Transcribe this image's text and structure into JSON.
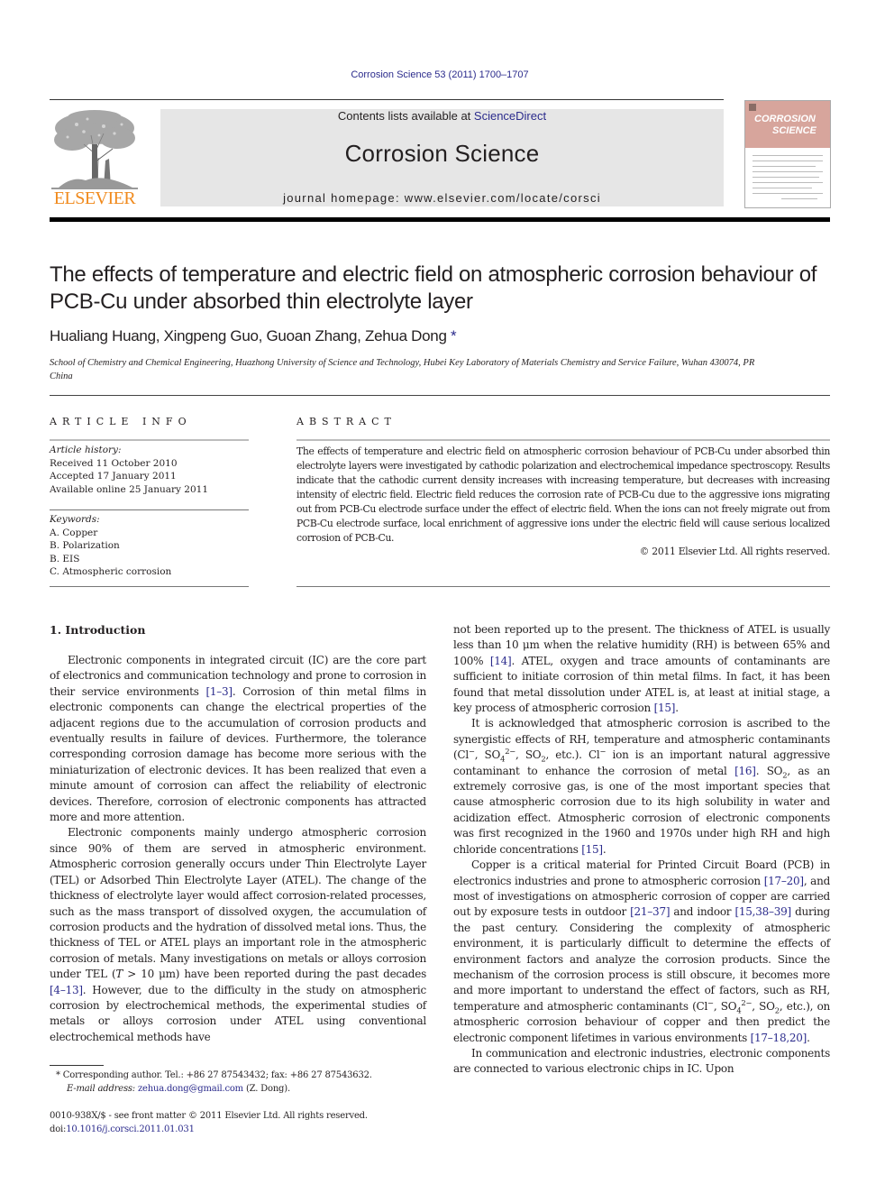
{
  "header": {
    "journal_ref": "Corrosion Science 53 (2011) 1700–1707",
    "contents_prefix": "Contents lists available at ",
    "contents_link": "ScienceDirect",
    "journal_title": "Corrosion Science",
    "homepage": "journal homepage: www.elsevier.com/locate/corsci",
    "publisher": "ELSEVIER",
    "cover_title_1": "CORROSION",
    "cover_title_2": "SCIENCE"
  },
  "article": {
    "title": "The effects of temperature and electric field on atmospheric corrosion behaviour of PCB-Cu under absorbed thin electrolyte layer",
    "authors": "Hualiang Huang, Xingpeng Guo, Guoan Zhang, Zehua Dong",
    "author_mark": "*",
    "affiliation": "School of Chemistry and Chemical Engineering, Huazhong University of Science and Technology, Hubei Key Laboratory of Materials Chemistry and Service Failure, Wuhan 430074, PR China"
  },
  "article_info": {
    "heading": "ARTICLE INFO",
    "history_label": "Article history:",
    "history": [
      "Received 11 October 2010",
      "Accepted 17 January 2011",
      "Available online 25 January 2011"
    ],
    "keywords_label": "Keywords:",
    "keywords": [
      "A. Copper",
      "B. Polarization",
      "B. EIS",
      "C. Atmospheric corrosion"
    ]
  },
  "abstract": {
    "heading": "ABSTRACT",
    "text": "The effects of temperature and electric field on atmospheric corrosion behaviour of PCB-Cu under absorbed thin electrolyte layers were investigated by cathodic polarization and electrochemical impedance spectroscopy. Results indicate that the cathodic current density increases with increasing temperature, but decreases with increasing intensity of electric field. Electric field reduces the corrosion rate of PCB-Cu due to the aggressive ions migrating out from PCB-Cu electrode surface under the effect of electric field. When the ions can not freely migrate out from PCB-Cu electrode surface, local enrichment of aggressive ions under the electric field will cause serious localized corrosion of PCB-Cu.",
    "copyright": "© 2011 Elsevier Ltd. All rights reserved."
  },
  "body": {
    "section_heading": "1. Introduction",
    "left": {
      "p1_a": "Electronic components in integrated circuit (IC) are the core part of electronics and communication technology and prone to corrosion in their service environments ",
      "p1_ref1": "[1–3]",
      "p1_b": ". Corrosion of thin metal films in electronic components can change the electrical properties of the adjacent regions due to the accumulation of corrosion products and eventually results in failure of devices. Furthermore, the tolerance corresponding corrosion damage has become more serious with the miniaturization of electronic devices. It has been realized that even a minute amount of corrosion can affect the reliability of electronic devices. Therefore, corrosion of electronic components has attracted more and more attention.",
      "p2_a": "Electronic components mainly undergo atmospheric corrosion since 90% of them are served in atmospheric environment. Atmospheric corrosion generally occurs under Thin Electrolyte Layer (TEL) or Adsorbed Thin Electrolyte Layer (ATEL). The change of the thickness of electrolyte layer would affect corrosion-related processes, such as the mass transport of dissolved oxygen, the accumulation of corrosion products and the hydration of dissolved metal ions. Thus, the thickness of TEL or ATEL plays an important role in the atmospheric corrosion of metals. Many investigations on metals or alloys corrosion under TEL (",
      "p2_T": "T",
      "p2_b": " > 10 μm) have been reported during the past decades ",
      "p2_ref1": "[4–13]",
      "p2_c": ". However, due to the difficulty in the study on atmospheric corrosion by electrochemical methods, the experimental studies of metals or alloys corrosion under ATEL using conventional electrochemical methods have"
    },
    "right": {
      "p1_a": "not been reported up to the present. The thickness of ATEL is usually less than 10 μm when the relative humidity (RH) is between 65% and 100% ",
      "p1_ref1": "[14]",
      "p1_b": ". ATEL, oxygen and trace amounts of contaminants are sufficient to initiate corrosion of thin metal films. In fact, it has been found that metal dissolution under ATEL is, at least at initial stage, a key process of atmospheric corrosion ",
      "p1_ref2": "[15]",
      "p1_c": ".",
      "p2_a": "It is acknowledged that atmospheric corrosion is ascribed to the synergistic effects of RH, temperature and atmospheric contaminants (Cl",
      "p2_b": ", SO",
      "p2_c": ", SO",
      "p2_d": ", etc.). Cl",
      "p2_e": " ion is an important natural aggressive contaminant to enhance the corrosion of metal ",
      "p2_ref1": "[16]",
      "p2_f": ". SO",
      "p2_g": ", as an extremely corrosive gas, is one of the most important species that cause atmospheric corrosion due to its high solubility in water and acidization effect. Atmospheric corrosion of electronic components was first recognized in the 1960 and 1970s under high RH and high chloride concentrations ",
      "p2_ref2": "[15]",
      "p2_h": ".",
      "p3_a": "Copper is a critical material for Printed Circuit Board (PCB) in electronics industries and prone to atmospheric corrosion ",
      "p3_ref1": "[17–20]",
      "p3_b": ", and most of investigations on atmospheric corrosion of copper are carried out by exposure tests in outdoor ",
      "p3_ref2": "[21–37]",
      "p3_c": " and indoor ",
      "p3_ref3": "[15,38–39]",
      "p3_d": " during the past century. Considering the complexity of atmospheric environment, it is particularly difficult to determine the effects of environment factors and analyze the corrosion products. Since the mechanism of the corrosion process is still obscure, it becomes more and more important to understand the effect of factors, such as RH, temperature and atmospheric contaminants (Cl",
      "p3_e": ", SO",
      "p3_f": ", SO",
      "p3_g": ", etc.), on atmospheric corrosion behaviour of copper and then predict the electronic component lifetimes in various environments ",
      "p3_ref4": "[17–18,20]",
      "p3_h": ".",
      "p4": "In communication and electronic industries, electronic components are connected to various electronic chips in IC. Upon",
      "sup_minus": "−",
      "sup_2minus": "2−",
      "sub_4": "4",
      "sub_2": "2"
    }
  },
  "footnotes": {
    "star": "*",
    "corresponding": "Corresponding author. Tel.: +86 27 87543432; fax: +86 27 87543632.",
    "email_label": "E-mail address: ",
    "email": "zehua.dong@gmail.com",
    "email_suffix": " (Z. Dong).",
    "issn": "0010-938X/$ - see front matter © 2011 Elsevier Ltd. All rights reserved.",
    "doi_label": "doi:",
    "doi": "10.1016/j.corsci.2011.01.031"
  },
  "colors": {
    "link": "#2b2b8c",
    "elsevier_orange": "#f08a1d",
    "masthead_grey": "#e6e6e6",
    "cover_pink": "#d7a59c"
  }
}
